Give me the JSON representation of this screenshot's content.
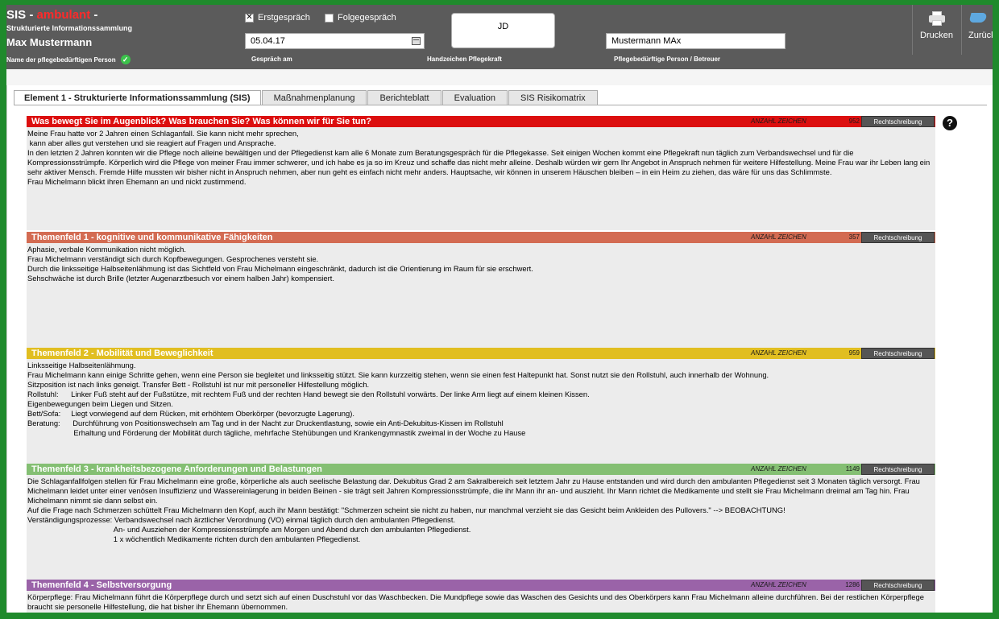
{
  "header": {
    "app_title_prefix": "SIS - ",
    "app_title_accent": "ambulant",
    "app_title_suffix": " -",
    "app_subtitle": "Strukturierte Informationssammlung",
    "patient_name": "Max Mustermann",
    "patient_label": "Name der pflegebedürftigen Person",
    "erstgespraech_label": "Erstgespräch",
    "erstgespraech_checked": "✕",
    "folgegespraech_label": "Folgegespräch",
    "date_value": "05.04.17",
    "date_label": "Gespräch am",
    "initials_value": "JD",
    "initials_label": "Handzeichen Pflegekraft",
    "person_value": "Mustermann MAx",
    "person_label": "Pflegebedürftige Person / Betreuer",
    "print_label": "Drucken",
    "back_label": "Zurück"
  },
  "tabs": [
    {
      "label": "Element 1 - Strukturierte Informationssammlung (SIS)",
      "active": true
    },
    {
      "label": "Maßnahmenplanung"
    },
    {
      "label": "Berichteblatt"
    },
    {
      "label": "Evaluation"
    },
    {
      "label": "SIS Risikomatrix"
    }
  ],
  "common": {
    "count_label": "ANZAHL ZEICHEN",
    "spell_label": "Rechtschreibung",
    "help_glyph": "?"
  },
  "sections": [
    {
      "title": "Was bewegt Sie im Augenblick? Was brauchen Sie? Was können wir für Sie tun?",
      "count": "952",
      "color": "#dc0f0f",
      "text": "Meine Frau hatte vor 2 Jahren einen Schlaganfall. Sie kann nicht mehr sprechen,\n kann aber alles gut verstehen und sie reagiert auf Fragen und Ansprache.\nIn den letzten 2 Jahren konnten wir die Pflege noch alleine bewältigen und der Pflegedienst kam alle 6 Monate zum Beratungsgespräch für die Pflegekasse. Seit einigen Wochen kommt eine Pflegekraft nun täglich zum Verbandswechsel und für die Kompressionsstrümpfe. Körperlich wird die Pflege von meiner Frau immer schwerer, und ich habe es ja so im Kreuz und schaffe das nicht mehr alleine. Deshalb würden wir gern Ihr Angebot in Anspruch nehmen für weitere Hilfestellung. Meine Frau war ihr Leben lang ein sehr aktiver Mensch. Fremde Hilfe mussten wir bisher nicht in Anspruch nehmen, aber nun geht es einfach nicht mehr anders. Hauptsache, wir können in unserem Häuschen bleiben – in ein Heim zu ziehen, das wäre für uns das Schlimmste.\nFrau Michelmann blickt ihren Ehemann an und nickt zustimmend."
    },
    {
      "title": "Themenfeld 1 - kognitive und kommunikative Fähigkeiten",
      "count": "357",
      "color": "#d36b52",
      "text": "Aphasie, verbale Kommunikation nicht möglich.\nFrau Michelmann verständigt sich durch Kopfbewegungen. Gesprochenes versteht sie.\nDurch die linksseitige Halbseitenlähmung ist das Sichtfeld von Frau Michelmann eingeschränkt, dadurch ist die Orientierung im Raum für sie erschwert.\nSehschwäche ist durch Brille (letzter Augenarztbesuch vor einem halben Jahr) kompensiert."
    },
    {
      "title": "Themenfeld 2 - Mobilität und Beweglichkeit",
      "count": "959",
      "color": "#e1be21",
      "text": "Linksseitige Halbseitenlähmung.\nFrau Michelmann kann einige Schritte gehen, wenn eine Person sie begleitet und linksseitig stützt. Sie kann kurzzeitig stehen, wenn sie einen fest Haltepunkt hat. Sonst nutzt sie den Rollstuhl, auch innerhalb der Wohnung.\nSitzposition ist nach links geneigt. Transfer Bett - Rollstuhl ist nur mit personeller Hilfestellung möglich.\nRollstuhl:      Linker Fuß steht auf der Fußstütze, mit rechtem Fuß und der rechten Hand bewegt sie den Rollstuhl vorwärts. Der linke Arm liegt auf einem kleinen Kissen.\nEigenbewegungen beim Liegen und Sitzen.\nBett/Sofa:     Liegt vorwiegend auf dem Rücken, mit erhöhtem Oberkörper (bevorzugte Lagerung).\nBeratung:      Durchführung von Positionswechseln am Tag und in der Nacht zur Druckentlastung, sowie ein Anti-Dekubitus-Kissen im Rollstuhl\n                      Erhaltung und Förderung der Mobilität durch tägliche, mehrfache Stehübungen und Krankengymnastik zweimal in der Woche zu Hause"
    },
    {
      "title": "Themenfeld 3 - krankheitsbezogene Anforderungen und Belastungen",
      "count": "1149",
      "color": "#84bf73",
      "text": "Die Schlaganfallfolgen stellen für Frau Michelmann eine große, körperliche als auch seelische Belastung dar. Dekubitus Grad 2 am Sakralbereich seit letztem Jahr zu Hause entstanden und wird durch den ambulanten Pflegedienst seit 3 Monaten täglich versorgt. Frau Michelmann leidet unter einer venösen Insuffizienz und Wassereinlagerung in beiden Beinen - sie trägt seit Jahren Kompressionsstrümpfe, die ihr Mann ihr an- und auszieht. Ihr Mann richtet die Medikamente und stellt sie Frau Michelmann dreimal am Tag hin. Frau Michelmann nimmt sie dann selbst ein.\nAuf die Frage nach Schmerzen schüttelt Frau Michelmann den Kopf, auch ihr Mann bestätigt: \"Schmerzen scheint sie nicht zu haben, nur manchmal verzieht sie das Gesicht beim Ankleiden des Pullovers.\" --> BEOBACHTUNG!\nVerständigungsprozesse: Verbandswechsel nach ärztlicher Verordnung (VO) einmal täglich durch den ambulanten Pflegedienst.\n                                         An- und Ausziehen der Kompressionsstrümpfe am Morgen und Abend durch den ambulanten Pflegedienst.\n                                         1 x wöchentlich Medikamente richten durch den ambulanten Pflegedienst."
    },
    {
      "title": "Themenfeld 4 - Selbstversorgung",
      "count": "1286",
      "color": "#9a63a8",
      "text": "Körperpflege: Frau Michelmann führt die Körperpflege durch und setzt sich auf einen Duschstuhl vor das Waschbecken. Die Mundpflege sowie das Waschen des Gesichts und des Oberkörpers kann Frau Michelmann alleine durchführen. Bei der restlichen Körperpflege braucht sie personelle Hilfestellung, die hat bisher ihr Ehemann übernommen.\nKleidung: Frau Michelmann trägt leicht zu öffnende, legere Kleidung, z. B. Jogginghose, damit das Wechseln der Windel so leicht wie möglich ist. Ihr Ehemann unterstützt sie beim An- und Auskleiden."
    }
  ]
}
